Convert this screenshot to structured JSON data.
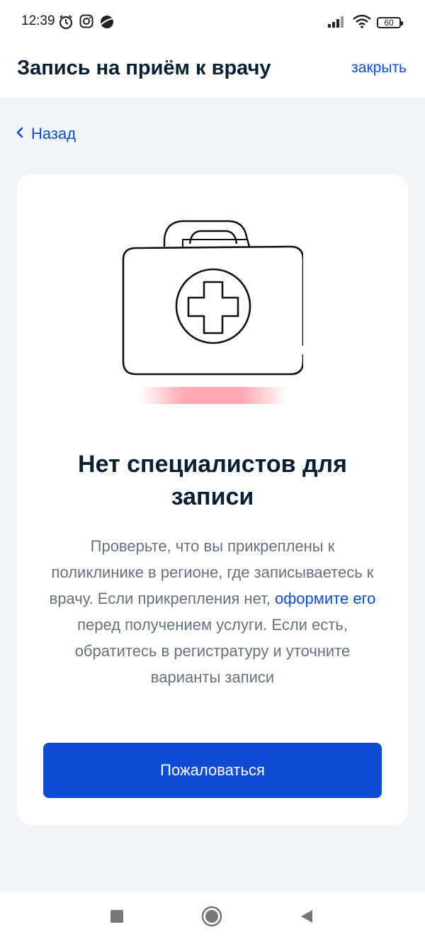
{
  "status_bar": {
    "time": "12:39",
    "battery": "60",
    "icons_left": [
      "alarm-icon",
      "instagram-icon",
      "planet-icon"
    ],
    "icons_right": [
      "signal-icon",
      "wifi-icon",
      "battery-icon"
    ]
  },
  "header": {
    "title": "Запись на приём к врачу",
    "close_label": "закрыть"
  },
  "nav": {
    "back_label": "Назад"
  },
  "card": {
    "title": "Нет специалистов для записи",
    "body_before_link": "Проверьте, что вы прикреплены к поликлинике в регионе, где записываетесь к врачу. Если прикрепления нет, ",
    "body_link": "оформите его",
    "body_after_link": " перед получением услуги. Если есть, обратитесь в регистратуру и уточните варианты записи",
    "button_label": "Пожаловаться",
    "illustration": "medical-kit-icon"
  },
  "colors": {
    "accent": "#0d4cd3",
    "background": "#f1f4f9",
    "title": "#0b1f33",
    "body_text": "#66727f",
    "shadow_pink": "#ff9ba5"
  },
  "system_nav": {
    "buttons": [
      "square-icon",
      "circle-icon",
      "triangle-back-icon"
    ]
  }
}
